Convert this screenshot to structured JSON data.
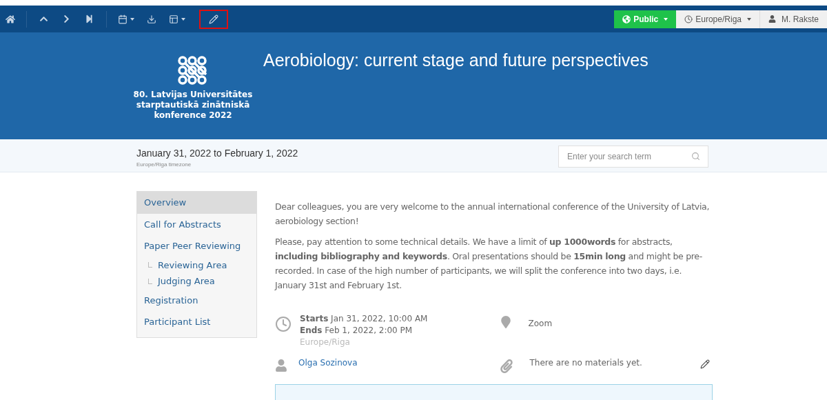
{
  "toolbar": {
    "edit_highlighted": true
  },
  "top_right": {
    "visibility": "Public",
    "timezone": "Europe/Riga",
    "user": "M. Rakste"
  },
  "banner": {
    "logo_text": [
      "80. Latvijas Universitātes",
      "starptautiskā zinātniskā",
      "konference 2022"
    ],
    "title": "Aerobiology: current stage and future perspectives"
  },
  "date_bar": {
    "dates": "January 31, 2022 to February 1, 2022",
    "timezone_note": "Europe/Riga timezone",
    "search": {
      "placeholder": "Enter your search term"
    }
  },
  "menu": [
    {
      "label": "Overview",
      "selected": true
    },
    {
      "label": "Call for Abstracts",
      "selected": false
    },
    {
      "label": "Paper Peer Reviewing",
      "selected": false,
      "children": [
        {
          "label": "Reviewing Area",
          "selected": false
        },
        {
          "label": "Judging Area",
          "selected": false
        }
      ]
    },
    {
      "label": "Registration",
      "selected": false
    },
    {
      "label": "Participant List",
      "selected": false
    }
  ],
  "paragraphs": [
    "Dear colleagues, you are very welcome to the annual international conference of the University of Latvia, aerobiology section!",
    "Please, pay attention to some technical details. We have a limit of **up 1000words** for abstracts, **including bibliography and keywords**.  Oral presentations should be **15min long** and might be pre-recorded. In case of the high number of participants, we will split the conference into two days, i.e. January 31st and February 1st."
  ],
  "details": {
    "starts_label": "Starts",
    "starts": "Jan 31, 2022, 10:00 AM",
    "ends_label": "Ends",
    "ends": "Feb 1, 2022, 2:00 PM",
    "timezone": "Europe/Riga",
    "location": "Zoom",
    "chair": "Olga Sozinova",
    "materials": "There are no materials yet."
  }
}
